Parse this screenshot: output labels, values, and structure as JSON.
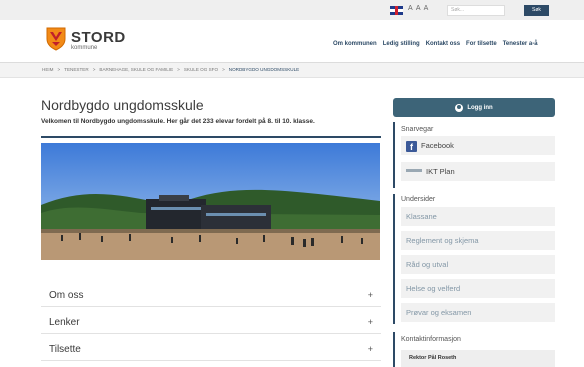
{
  "utility": {
    "font_size_label": "A A A",
    "search_placeholder": "Søk...",
    "search_button": "Søk"
  },
  "header": {
    "logo_title": "STORD",
    "logo_subtitle": "kommune",
    "nav": [
      "Om kommunen",
      "Ledig stilling",
      "Kontakt oss",
      "For tilsette",
      "Tenester a-å"
    ]
  },
  "breadcrumb": {
    "items": [
      "HEIM",
      ">",
      "TENESTER",
      ">",
      "BARNEHAGE, SKULE OG FAMILIE",
      ">",
      "SKULE OG SFO",
      ">"
    ],
    "current": "NORDBYGDO UNGDOMSSKULE"
  },
  "main": {
    "title": "Nordbygdo ungdomsskule",
    "intro": "Velkomen til Nordbygdo ungdomsskule. Her går det 233 elevar fordelt på 8. til 10. klasse.",
    "accordions": [
      {
        "label": "Om oss",
        "toggle": "+"
      },
      {
        "label": "Lenker",
        "toggle": "+"
      },
      {
        "label": "Tilsette",
        "toggle": "+"
      }
    ]
  },
  "sidebar": {
    "login_label": "Logg inn",
    "shortcuts_heading": "Snarvegar",
    "shortcuts": [
      "Facebook",
      "IKT Plan"
    ],
    "subpages_heading": "Undersider",
    "subpages": [
      "Klassane",
      "Reglement og skjema",
      "Råd og utval",
      "Helse og velferd",
      "Prøvar og eksamen"
    ],
    "contact_heading": "Kontaktinformasjon",
    "contact_name": "Rektor Pål Roseth"
  },
  "colors": {
    "brand": "#2d4a66",
    "login_button": "#3d6478",
    "facebook": "#3b5998"
  }
}
